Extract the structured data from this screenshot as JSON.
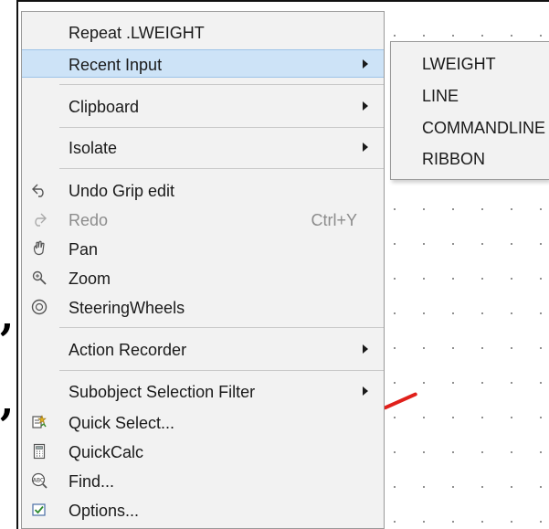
{
  "menu": {
    "items": [
      {
        "label": "Repeat .LWEIGHT"
      },
      {
        "label": "Recent Input"
      },
      {
        "label": "Clipboard"
      },
      {
        "label": "Isolate"
      },
      {
        "label": "Undo Grip edit"
      },
      {
        "label": "Redo",
        "shortcut": "Ctrl+Y"
      },
      {
        "label": "Pan"
      },
      {
        "label": "Zoom"
      },
      {
        "label": "SteeringWheels"
      },
      {
        "label": "Action Recorder"
      },
      {
        "label": "Subobject Selection Filter"
      },
      {
        "label": "Quick Select..."
      },
      {
        "label": "QuickCalc"
      },
      {
        "label": "Find..."
      },
      {
        "label": "Options..."
      }
    ]
  },
  "submenu": {
    "items": [
      {
        "label": "LWEIGHT"
      },
      {
        "label": "LINE"
      },
      {
        "label": "COMMANDLINE"
      },
      {
        "label": "RIBBON"
      }
    ]
  },
  "decor": {
    "commas": [
      ",",
      ","
    ]
  },
  "colors": {
    "highlight": "#cde3f7",
    "menu_bg": "#f2f2f2",
    "red_line": "#e0201b"
  },
  "icons": [
    "undo-icon",
    "redo-icon",
    "pan-icon",
    "zoom-icon",
    "steering-wheel-icon",
    "quick-select-icon",
    "calculator-icon",
    "find-icon",
    "options-checkbox-icon"
  ]
}
